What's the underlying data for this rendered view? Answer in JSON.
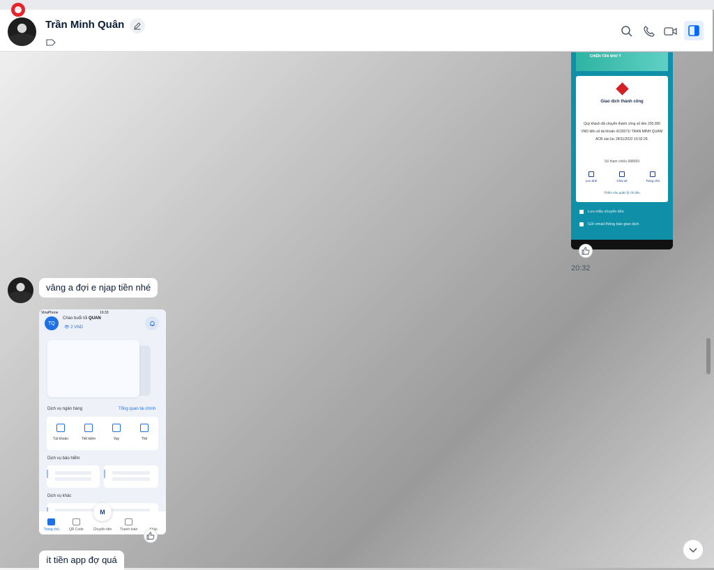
{
  "header": {
    "contact_name": "Trần Minh Quân"
  },
  "messages": {
    "sent_screenshot_time": "20:32",
    "received_1": "vâng a đợi e njap tiền nhé",
    "received_2": "ít tiền app đợ quá"
  },
  "transfer_screenshot": {
    "banner": "CHIẾN TÂN NHƯ Ý",
    "title": "Giao dịch thành công",
    "description": "Quý khách đã chuyển thành công số tiền 200,000 VND đến số tài khoản 4102071/ TRAN MINH QUAN/ ACB vào lúc 28/11/2022 19:32:29.",
    "reference": "Số tham chiếu 688969",
    "actions": [
      "Lưu ảnh",
      "Chia sẻ",
      "Trang chủ"
    ],
    "favorite": "Thêm vào quản lý chi tiêu",
    "checkboxes": [
      "Lưu mẫu chuyển tiền",
      "Gửi email thông báo giao dịch"
    ]
  },
  "banking_screenshot": {
    "carrier": "VinaPhone",
    "clock": "19:33",
    "initials": "TQ",
    "greeting": "Chào buổi tối",
    "user": "QUAN",
    "balance": "2 VND",
    "section_banking": "Dịch vụ ngân hàng",
    "overview_link": "Tổng quan tài chính",
    "services": [
      "Tài khoản",
      "Tiết kiệm",
      "Vay",
      "Thẻ"
    ],
    "section_insurance": "Dịch vụ bảo hiểm",
    "section_other": "Dịch vụ khác",
    "nav": [
      "Trang chủ",
      "QR Code",
      "Chuyển tiền",
      "Thanh toán",
      "Khác"
    ]
  }
}
